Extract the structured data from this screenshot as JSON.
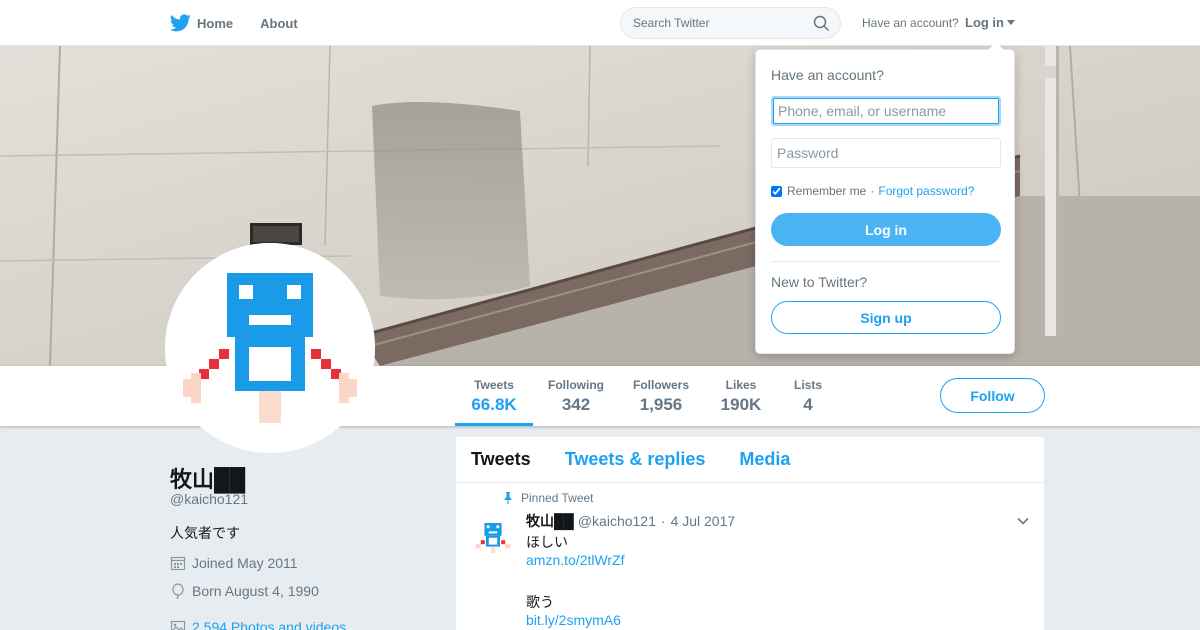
{
  "nav": {
    "home_label": "Home",
    "about_label": "About",
    "search_placeholder": "Search Twitter",
    "have_account": "Have an account?",
    "login_label": "Log in"
  },
  "profile_nav": {
    "stats": [
      {
        "label": "Tweets",
        "value": "66.8K"
      },
      {
        "label": "Following",
        "value": "342"
      },
      {
        "label": "Followers",
        "value": "1,956"
      },
      {
        "label": "Likes",
        "value": "190K"
      },
      {
        "label": "Lists",
        "value": "4"
      }
    ],
    "follow_label": "Follow"
  },
  "profile": {
    "name": "牧山██",
    "handle": "@kaicho121",
    "bio": "人気者です",
    "joined": "Joined May 2011",
    "born": "Born August 4, 1990",
    "photos": "2,594 Photos and videos"
  },
  "timeline": {
    "tabs": [
      "Tweets",
      "Tweets & replies",
      "Media"
    ],
    "pinned_label": "Pinned Tweet",
    "tweet": {
      "name": "牧山██",
      "handle": "@kaicho121",
      "separator": "·",
      "date": "4 Jul 2017",
      "line1": "ほしい",
      "link1": "amzn.to/2tlWrZf",
      "line2": "歌う",
      "link2": "bit.ly/2smymA6"
    }
  },
  "login_dropdown": {
    "heading": "Have an account?",
    "username_placeholder": "Phone, email, or username",
    "password_placeholder": "Password",
    "remember_label": "Remember me",
    "separator": "·",
    "forgot_label": "Forgot password?",
    "login_button": "Log in",
    "new_label": "New to Twitter?",
    "signup_button": "Sign up"
  },
  "colors": {
    "accent": "#1da1f2",
    "login_button": "#4ab3f4",
    "page_bg": "#e6ecf0"
  }
}
